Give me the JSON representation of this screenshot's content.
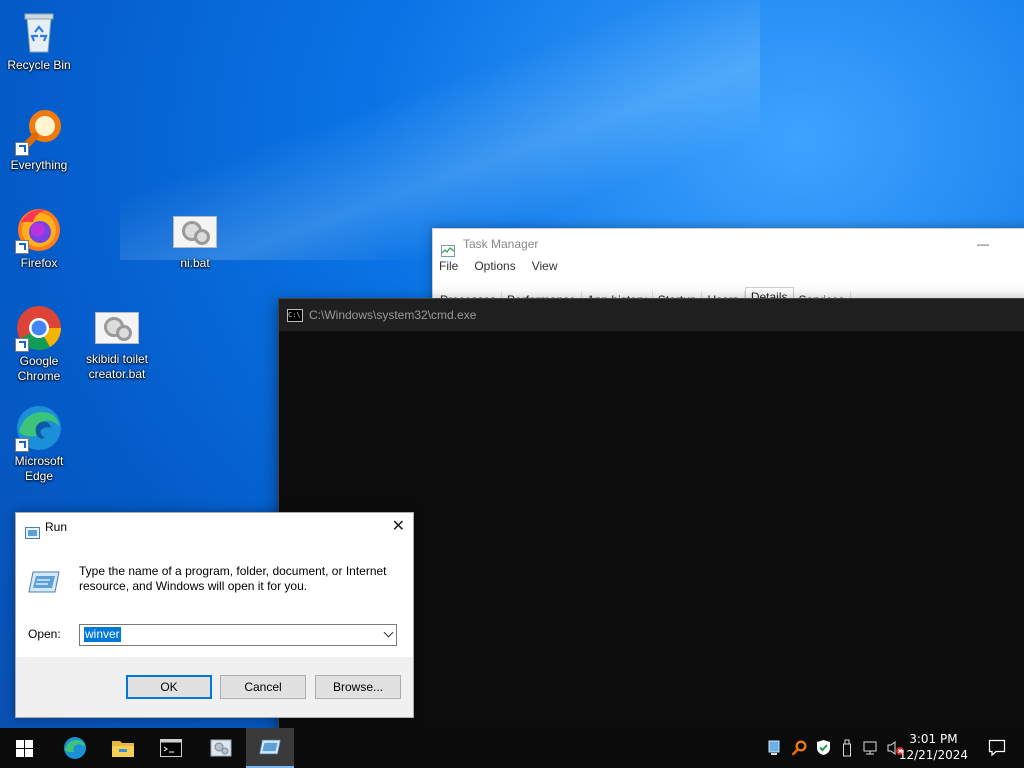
{
  "desktop": {
    "icons": [
      {
        "label": "Recycle Bin"
      },
      {
        "label": "Everything"
      },
      {
        "label": "Firefox"
      },
      {
        "label": "ni.bat"
      },
      {
        "label": "Google Chrome"
      },
      {
        "label": "skibidi toilet creator.bat"
      },
      {
        "label": "Microsoft Edge"
      }
    ]
  },
  "task_manager": {
    "title": "Task Manager",
    "menu": [
      "File",
      "Options",
      "View"
    ],
    "tabs": [
      "Processes",
      "Performance",
      "App history",
      "Startup",
      "Users",
      "Details",
      "Services"
    ],
    "active_tab": "Details"
  },
  "cmd": {
    "title": "C:\\Windows\\system32\\cmd.exe",
    "icon_text": "C:\\"
  },
  "run_dialog": {
    "title": "Run",
    "description": "Type the name of a program, folder, document, or Internet resource, and Windows will open it for you.",
    "open_label": "Open:",
    "open_value": "winver",
    "ok_label": "OK",
    "cancel_label": "Cancel",
    "browse_label": "Browse...",
    "close_glyph": "✕"
  },
  "taskbar": {
    "time": "3:01 PM",
    "date": "12/21/2024",
    "pinned": [
      "start-icon",
      "edge-icon",
      "file-explorer-icon",
      "cmd-icon",
      "bat-file-icon",
      "run-icon"
    ]
  },
  "colors": {
    "accent": "#0078d7",
    "taskbar": "#0b0b0b",
    "cmd_bg": "#0c0c0c"
  }
}
